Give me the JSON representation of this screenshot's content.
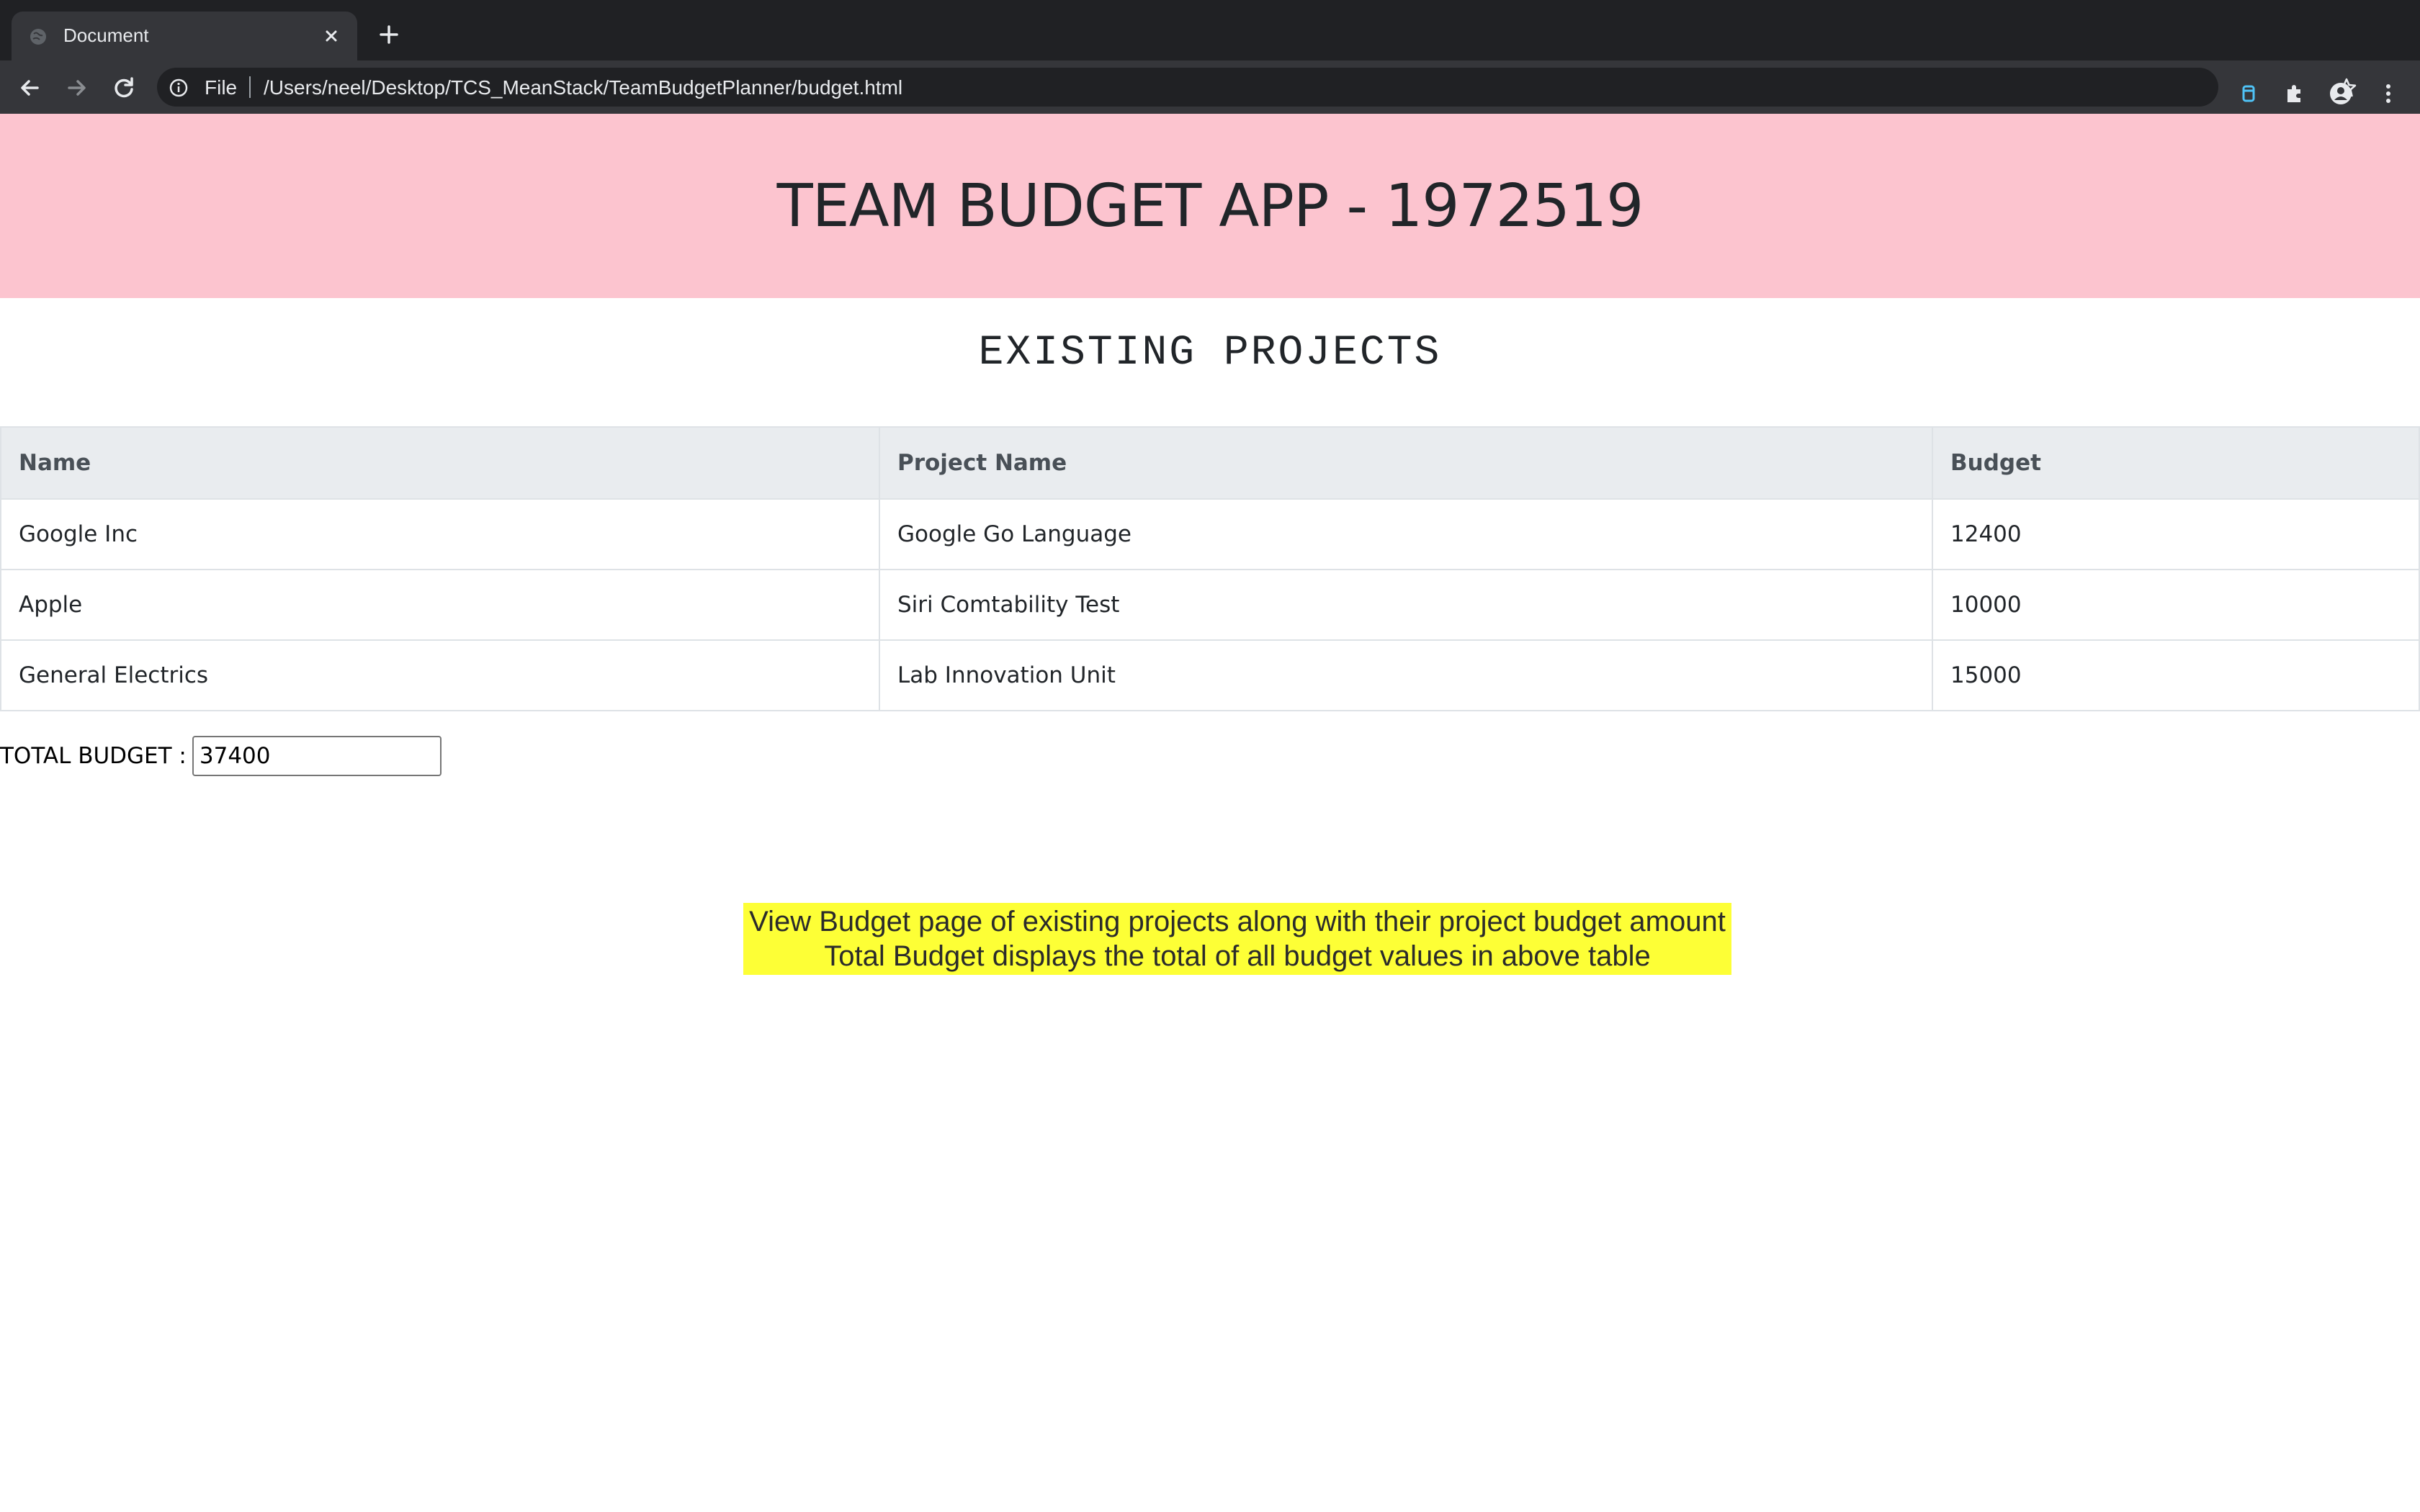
{
  "browser": {
    "tab_title": "Document",
    "address_scheme": "File",
    "address_url": "/Users/neel/Desktop/TCS_MeanStack/TeamBudgetPlanner/budget.html"
  },
  "page": {
    "header_title": "TEAM BUDGET APP - 1972519",
    "section_title": "EXISTING PROJECTS",
    "table": {
      "columns": [
        "Name",
        "Project Name",
        "Budget"
      ],
      "rows": [
        [
          "Google Inc",
          "Google Go Language",
          "12400"
        ],
        [
          "Apple",
          "Siri Comtability Test",
          "10000"
        ],
        [
          "General Electrics",
          "Lab Innovation Unit",
          "15000"
        ]
      ]
    },
    "total_label": "TOTAL BUDGET :",
    "total_value": "37400",
    "note_line1": "View Budget page of existing projects along with their project budget amount",
    "note_line2": "Total Budget displays the total of all budget values in above table"
  },
  "colors": {
    "header_bg": "#fcc4cf",
    "note_bg": "#fdff36",
    "table_header_bg": "#e9ecef",
    "chrome_dark": "#202124",
    "chrome_toolbar": "#35363a"
  }
}
